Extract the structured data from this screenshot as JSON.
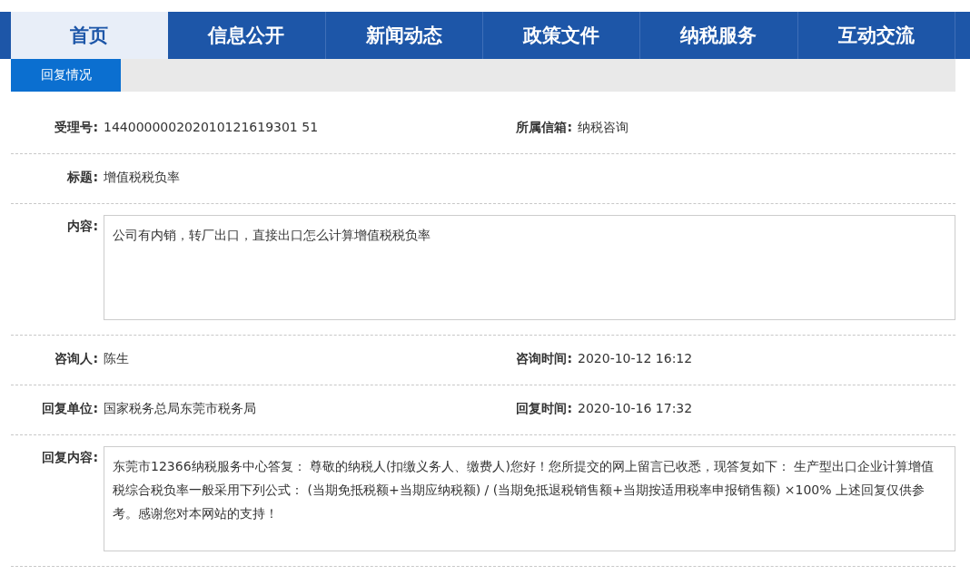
{
  "nav": {
    "tabs": [
      {
        "label": "首页",
        "selected": true
      },
      {
        "label": "信息公开",
        "selected": false
      },
      {
        "label": "新闻动态",
        "selected": false
      },
      {
        "label": "政策文件",
        "selected": false
      },
      {
        "label": "纳税服务",
        "selected": false
      },
      {
        "label": "互动交流",
        "selected": false
      }
    ]
  },
  "section_tabs": [
    {
      "label": "回复情况",
      "selected": true
    }
  ],
  "rows": [
    {
      "kind": "pair",
      "fields": [
        {
          "label": "受理号:",
          "value": "144000000202010121619301 51"
        },
        {
          "label": "所属信箱:",
          "value": "纳税咨询"
        }
      ]
    },
    {
      "kind": "single",
      "fields": [
        {
          "label": "标题:",
          "value": "增值税税负率"
        }
      ]
    },
    {
      "kind": "textbox",
      "fields": [
        {
          "label": "内容:",
          "value": "公司有内销，转厂出口，直接出口怎么计算增值税税负率"
        }
      ]
    },
    {
      "kind": "pair",
      "fields": [
        {
          "label": "咨询人:",
          "value": "陈生"
        },
        {
          "label": "咨询时间:",
          "value": "2020-10-12 16:12"
        }
      ]
    },
    {
      "kind": "pair",
      "fields": [
        {
          "label": "回复单位:",
          "value": "国家税务总局东莞市税务局"
        },
        {
          "label": "回复时间:",
          "value": "2020-10-16 17:32"
        }
      ]
    },
    {
      "kind": "textbox",
      "fields": [
        {
          "label": "回复内容:",
          "value": "东莞市12366纳税服务中心答复：  尊敬的纳税人(扣缴义务人、缴费人)您好！您所提交的网上留言已收悉，现答复如下：  生产型出口企业计算增值税综合税负率一般采用下列公式：  (当期免抵税额+当期应纳税额) / (当期免抵退税销售额+当期按适用税率申报销售额) ×100% 上述回复仅供参考。感谢您对本网站的支持！"
        }
      ]
    }
  ]
}
